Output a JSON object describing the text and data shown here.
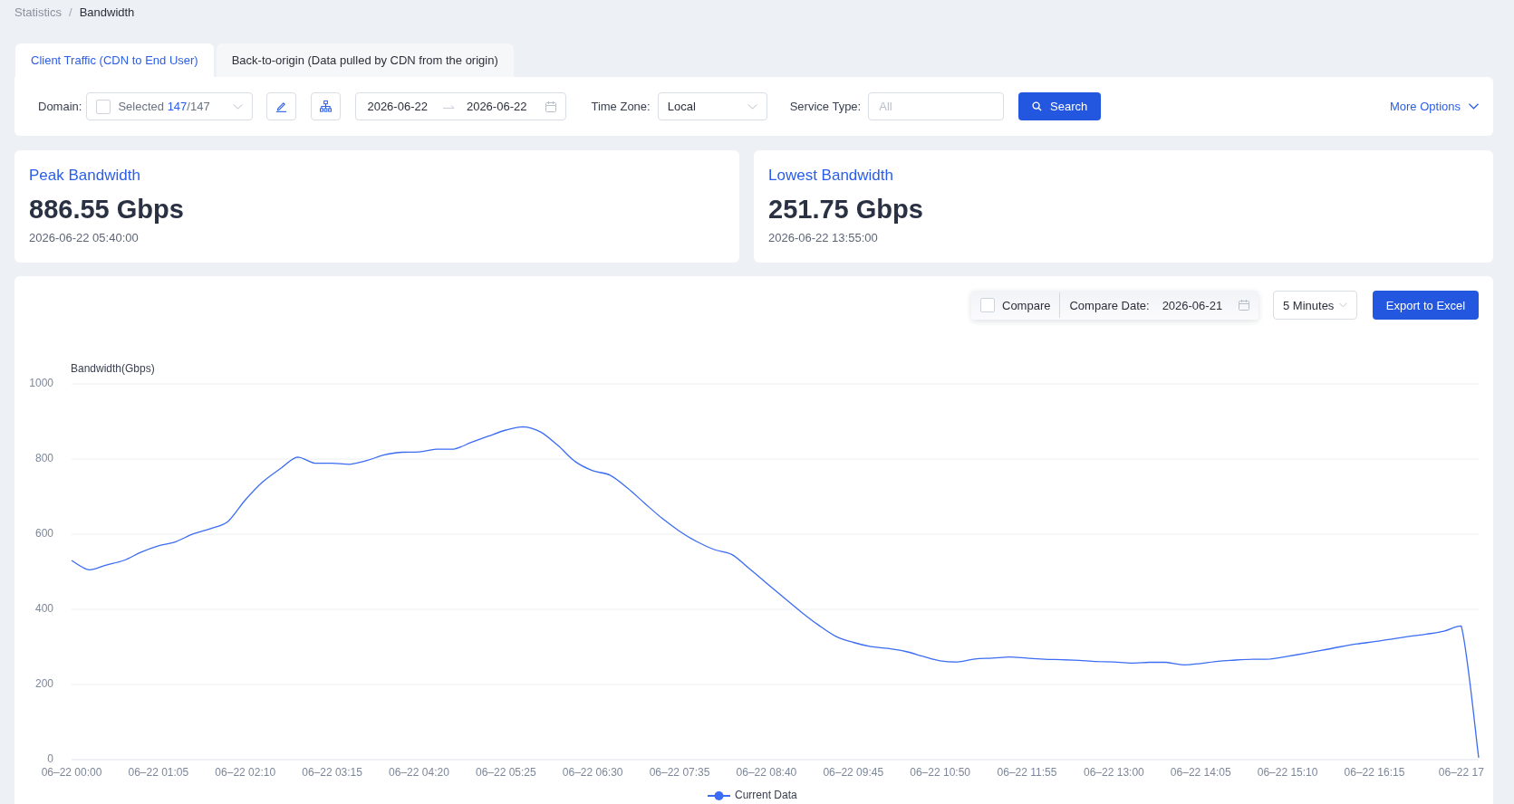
{
  "breadcrumb": {
    "separator": "/",
    "items": [
      {
        "label": "Statistics",
        "current": false
      },
      {
        "label": "Bandwidth",
        "current": true
      }
    ]
  },
  "tabs": [
    {
      "label": "Client Traffic (CDN to End User)",
      "selected": true
    },
    {
      "label": "Back-to-origin (Data pulled by CDN from the origin)",
      "selected": false
    }
  ],
  "filters": {
    "domain": {
      "label": "Domain:",
      "checked": false,
      "prefix": "Selected",
      "selected_count": "147",
      "total": "/147"
    },
    "date_range": {
      "start": "2026-06-22",
      "end": "2026-06-22"
    },
    "time_zone": {
      "label": "Time Zone:",
      "value": "Local"
    },
    "service_type": {
      "label": "Service Type:",
      "placeholder": "All"
    },
    "search_button": "Search",
    "more_options": "More Options"
  },
  "stats": [
    {
      "title": "Peak Bandwidth",
      "value": "886.55 Gbps",
      "time": "2026-06-22 05:40:00"
    },
    {
      "title": "Lowest Bandwidth",
      "value": "251.75 Gbps",
      "time": "2026-06-22 13:55:00"
    }
  ],
  "chart_panel": {
    "compare": {
      "label": "Compare",
      "checked": false,
      "date_label": "Compare Date:",
      "date": "2026-06-21"
    },
    "granularity": "5 Minutes",
    "export_button": "Export to Excel",
    "chart_data": {
      "type": "line",
      "ylabel": "Bandwidth(Gbps)",
      "ylim": [
        0,
        1000
      ],
      "yticks": [
        0,
        200,
        400,
        600,
        800,
        1000
      ],
      "grid": true,
      "categories": [
        "06–22 00:00",
        null,
        null,
        null,
        null,
        "06–22 01:05",
        null,
        null,
        null,
        null,
        "06–22 02:10",
        null,
        null,
        null,
        null,
        "06–22 03:15",
        null,
        null,
        null,
        null,
        "06–22 04:20",
        null,
        null,
        null,
        null,
        "06–22 05:25",
        null,
        null,
        null,
        null,
        "06–22 06:30",
        null,
        null,
        null,
        null,
        "06–22 07:35",
        null,
        null,
        null,
        null,
        "06–22 08:40",
        null,
        null,
        null,
        null,
        "06–22 09:45",
        null,
        null,
        null,
        null,
        "06–22 10:50",
        null,
        null,
        null,
        null,
        "06–22 11:55",
        null,
        null,
        null,
        null,
        "06–22 13:00",
        null,
        null,
        null,
        null,
        "06–22 14:05",
        null,
        null,
        null,
        null,
        "06–22 15:10",
        null,
        null,
        null,
        null,
        "06–22 16:15",
        null,
        null,
        null,
        null,
        "06–22 17",
        null
      ],
      "series": [
        {
          "name": "Current Data",
          "color": "#3b6cf3",
          "values": [
            530,
            505,
            518,
            530,
            552,
            569,
            580,
            601,
            615,
            634,
            691,
            739,
            774,
            805,
            789,
            789,
            786,
            796,
            811,
            818,
            819,
            826,
            826,
            844,
            861,
            877,
            886,
            872,
            836,
            793,
            769,
            757,
            723,
            682,
            642,
            608,
            580,
            559,
            546,
            509,
            470,
            431,
            393,
            358,
            328,
            312,
            301,
            296,
            288,
            275,
            263,
            260,
            268,
            270,
            273,
            270,
            267,
            266,
            264,
            261,
            260,
            257,
            259,
            259,
            252,
            256,
            262,
            265,
            267,
            268,
            275,
            283,
            291,
            300,
            308,
            314,
            321,
            328,
            334,
            342,
            356,
            5
          ]
        }
      ]
    }
  }
}
